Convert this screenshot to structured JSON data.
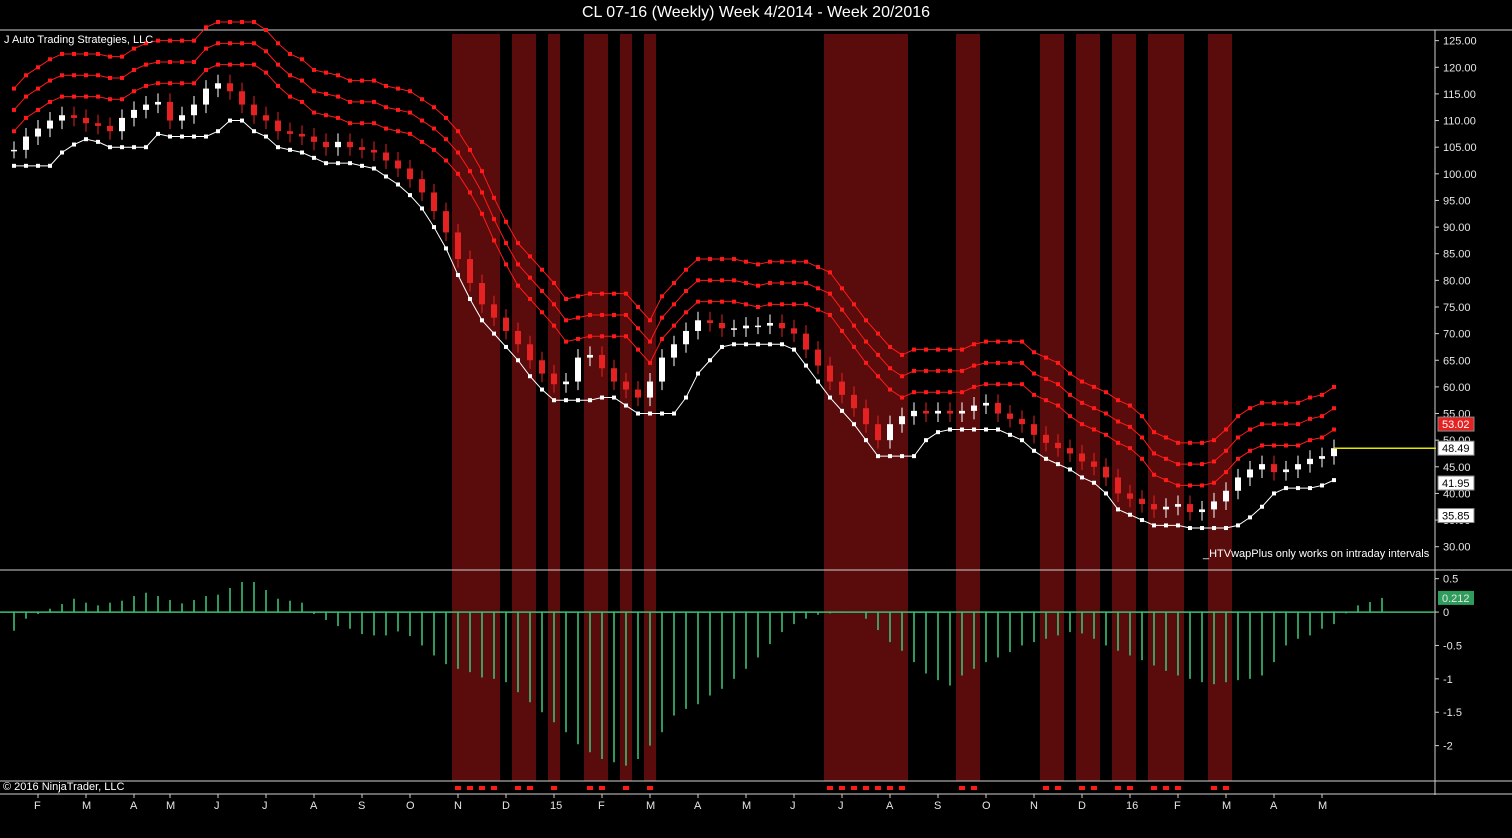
{
  "window": {
    "title": "CL 07-16 (Weekly)  Week 4/2014 - Week 20/2016",
    "vendor": "J Auto Trading Strategies, LLC",
    "copyright": "© 2016 NinjaTrader, LLC",
    "notice": "_HTVwapPlus only works on intraday intervals"
  },
  "colors": {
    "background": "#000000",
    "up_candle": "#ffffff",
    "down_candle": "#e52222",
    "band_red": "#ff1a1a",
    "band_white": "#ffffff",
    "shade": "#5a0b0b",
    "histogram": "#3dbf73",
    "zero_line": "#3dbf73",
    "last_price_line": "#e6e600"
  },
  "chart_data": [
    {
      "type": "candlestick",
      "title": "CL 07-16 (Weekly)  Week 4/2014 - Week 20/2016",
      "ylim": [
        26,
        127
      ],
      "yticks": [
        "125.00",
        "120.00",
        "115.00",
        "110.00",
        "105.00",
        "100.00",
        "95.00",
        "90.00",
        "85.00",
        "80.00",
        "75.00",
        "70.00",
        "65.00",
        "60.00",
        "55.00",
        "50.00",
        "45.00",
        "40.00",
        "35.00",
        "30.00"
      ],
      "xticks": [
        "F",
        "M",
        "A",
        "M",
        "J",
        "J",
        "A",
        "S",
        "O",
        "N",
        "D",
        "15",
        "F",
        "M",
        "A",
        "M",
        "J",
        "J",
        "A",
        "S",
        "O",
        "N",
        "D",
        "16",
        "F",
        "M",
        "A",
        "M"
      ],
      "price_labels": [
        {
          "value": "53.02",
          "style": "red"
        },
        {
          "value": "48.49",
          "style": "white"
        },
        {
          "value": "41.95",
          "style": "white"
        },
        {
          "value": "35.85",
          "style": "white"
        }
      ],
      "last_price": 48.49,
      "closes": [
        104.5,
        107.0,
        108.5,
        110.0,
        111.0,
        110.5,
        109.5,
        109.0,
        108.0,
        110.5,
        112.0,
        113.0,
        113.5,
        110.0,
        111.0,
        113.0,
        116.0,
        117.0,
        115.5,
        113.0,
        111.0,
        110.0,
        108.0,
        107.5,
        107.0,
        106.0,
        105.0,
        106.0,
        105.0,
        104.5,
        104.0,
        102.5,
        101.0,
        99.0,
        96.5,
        93.0,
        89.0,
        84.0,
        79.5,
        75.5,
        73.0,
        70.5,
        68.0,
        65.0,
        62.5,
        60.5,
        61.0,
        65.5,
        66.0,
        63.5,
        61.0,
        59.5,
        58.0,
        61.0,
        65.5,
        68.0,
        70.5,
        72.5,
        72.0,
        71.0,
        71.0,
        71.5,
        71.5,
        72.0,
        71.0,
        70.0,
        67.0,
        64.0,
        61.0,
        58.5,
        56.0,
        53.0,
        50.0,
        53.0,
        54.5,
        55.5,
        55.0,
        55.5,
        55.0,
        55.5,
        56.5,
        57.0,
        55.0,
        54.0,
        53.0,
        51.0,
        49.5,
        48.5,
        47.5,
        46.0,
        45.0,
        43.0,
        40.0,
        39.0,
        38.0,
        37.0,
        37.5,
        38.0,
        36.5,
        37.0,
        38.5,
        40.5,
        43.0,
        44.5,
        45.5,
        44.0,
        44.5,
        45.5,
        46.5,
        47.0,
        48.49
      ]
    },
    {
      "type": "bar",
      "name": "oscillator",
      "ylim": [
        -2.5,
        0.6
      ],
      "yticks": [
        "0.5",
        "0",
        "-0.5",
        "-1",
        "-1.5",
        "-2"
      ],
      "last_value_label": "0.212",
      "values": [
        -0.28,
        -0.1,
        -0.03,
        0.05,
        0.12,
        0.2,
        0.14,
        0.1,
        0.14,
        0.17,
        0.24,
        0.29,
        0.24,
        0.18,
        0.13,
        0.18,
        0.24,
        0.26,
        0.36,
        0.45,
        0.45,
        0.33,
        0.2,
        0.17,
        0.14,
        -0.03,
        -0.12,
        -0.21,
        -0.25,
        -0.33,
        -0.35,
        -0.35,
        -0.29,
        -0.36,
        -0.5,
        -0.65,
        -0.78,
        -0.85,
        -0.9,
        -0.98,
        -1.0,
        -1.05,
        -1.2,
        -1.35,
        -1.5,
        -1.65,
        -1.8,
        -1.98,
        -2.1,
        -2.2,
        -2.25,
        -2.3,
        -2.2,
        -2.0,
        -1.8,
        -1.55,
        -1.45,
        -1.38,
        -1.25,
        -1.15,
        -1.0,
        -0.85,
        -0.68,
        -0.48,
        -0.3,
        -0.18,
        -0.1,
        -0.04,
        -0.02,
        -0.01,
        0.0,
        -0.1,
        -0.27,
        -0.45,
        -0.58,
        -0.75,
        -0.92,
        -1.02,
        -1.1,
        -0.95,
        -0.85,
        -0.75,
        -0.68,
        -0.6,
        -0.5,
        -0.45,
        -0.4,
        -0.35,
        -0.3,
        -0.32,
        -0.4,
        -0.5,
        -0.58,
        -0.65,
        -0.72,
        -0.8,
        -0.88,
        -0.95,
        -1.0,
        -1.05,
        -1.08,
        -1.05,
        -1.02,
        -1.0,
        -0.95,
        -0.75,
        -0.5,
        -0.4,
        -0.35,
        -0.25,
        -0.18,
        -0.02,
        0.1,
        0.15,
        0.212
      ]
    },
    {
      "type": "bar",
      "name": "signal-markers",
      "values": [
        0,
        0,
        0,
        0,
        0,
        0,
        0,
        0,
        0,
        0,
        0,
        0,
        0,
        0,
        0,
        0,
        0,
        0,
        0,
        0,
        0,
        0,
        0,
        0,
        0,
        0,
        0,
        0,
        0,
        0,
        0,
        0,
        0,
        0,
        0,
        0,
        0,
        1,
        1,
        1,
        1,
        0,
        1,
        1,
        0,
        1,
        0,
        0,
        1,
        1,
        0,
        1,
        0,
        1,
        0,
        0,
        0,
        0,
        0,
        0,
        0,
        0,
        0,
        0,
        0,
        0,
        0,
        0,
        1,
        1,
        1,
        1,
        1,
        1,
        1,
        0,
        0,
        0,
        0,
        1,
        1,
        0,
        0,
        0,
        0,
        0,
        1,
        1,
        0,
        1,
        1,
        0,
        1,
        1,
        0,
        1,
        1,
        1,
        0,
        0,
        1,
        1,
        0,
        0,
        0,
        0,
        0,
        0,
        0,
        0,
        0,
        0,
        0,
        0,
        0
      ]
    }
  ]
}
